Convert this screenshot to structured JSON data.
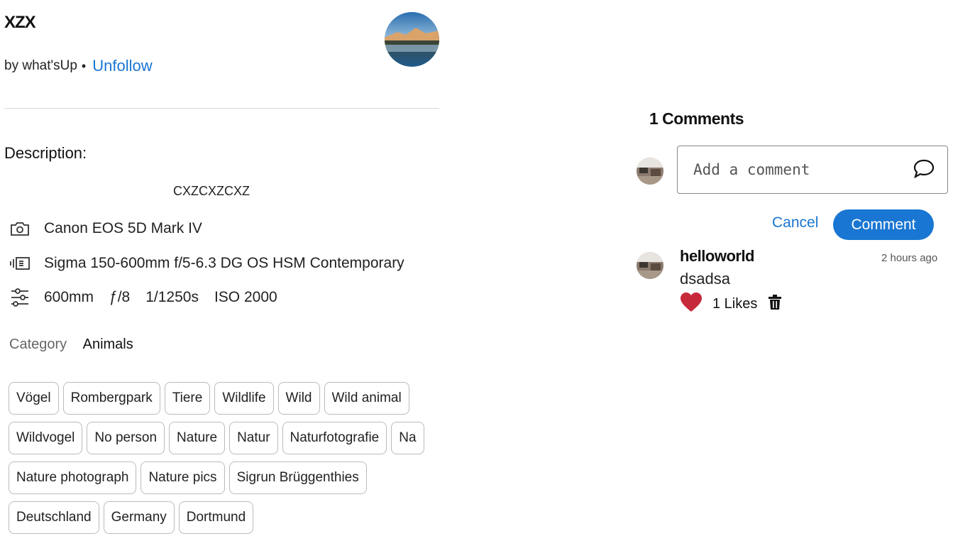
{
  "post": {
    "title": "XZX",
    "by_label": "by what'sUp",
    "dot": "•",
    "follow_label": "Unfollow"
  },
  "description": {
    "label": "Description:",
    "text": "CXZCXZCXZ"
  },
  "specs": {
    "camera": "Canon EOS 5D Mark IV",
    "lens": "Sigma 150-600mm f/5-6.3 DG OS HSM Contemporary",
    "focal": "600mm",
    "aperture": "ƒ/8",
    "shutter": "1/1250s",
    "iso": "ISO 2000"
  },
  "category": {
    "label": "Category",
    "value": "Animals"
  },
  "tags": [
    [
      "Vögel",
      "Rombergpark",
      "Tiere",
      "Wildlife",
      "Wild",
      "Wild animal"
    ],
    [
      "Wildvogel",
      "No person",
      "Nature",
      "Natur",
      "Naturfotografie",
      "Na"
    ],
    [
      "Nature photograph",
      "Nature pics",
      "Sigrun Brüggenthies"
    ],
    [
      "Deutschland",
      "Germany",
      "Dortmund"
    ]
  ],
  "comments": {
    "header": "1 Comments",
    "placeholder": "Add a comment",
    "cancel_label": "Cancel",
    "submit_label": "Comment",
    "items": [
      {
        "user": "helloworld",
        "time": "2 hours ago",
        "text": "dsadsa",
        "likes": "1 Likes"
      }
    ]
  },
  "colors": {
    "accent": "#1976d2",
    "heart": "#c62a3a"
  },
  "icons": {
    "camera": "camera-icon",
    "lens": "lens-icon",
    "settings": "sliders-icon",
    "comment": "chat-bubble-icon",
    "like": "heart-icon",
    "delete": "trash-icon"
  }
}
